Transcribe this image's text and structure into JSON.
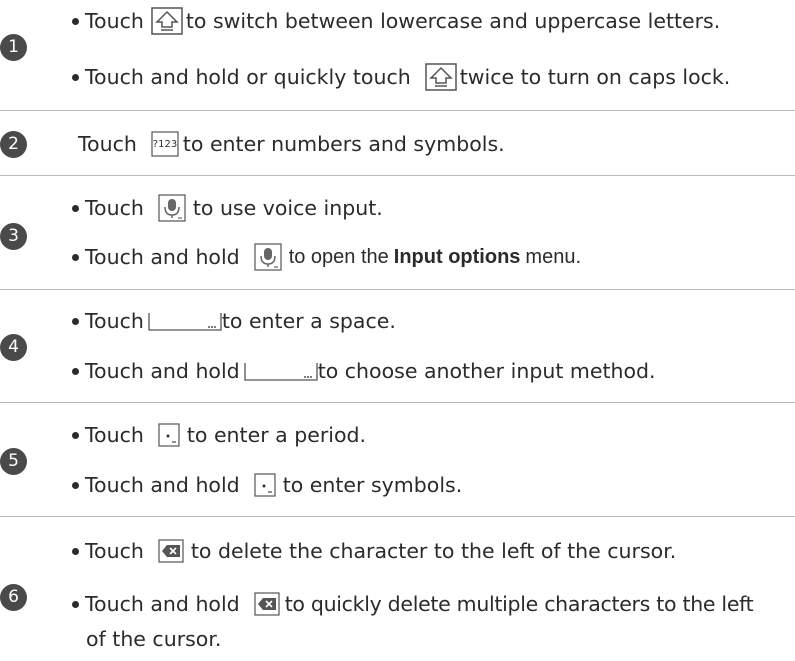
{
  "rows": [
    {
      "number": "1",
      "lines": [
        {
          "before": "Touch",
          "icon": "shift-icon",
          "after": "to switch between lowercase and uppercase letters."
        },
        {
          "before": "Touch and hold or quickly touch",
          "icon": "shift-icon",
          "after": "twice to turn on caps lock."
        }
      ]
    },
    {
      "number": "2",
      "lines": [
        {
          "before": "Touch",
          "icon": "numbers-symbols-key-icon",
          "icon_text": "?123",
          "after": "to enter numbers and symbols."
        }
      ]
    },
    {
      "number": "3",
      "lines": [
        {
          "before": "Touch",
          "icon": "microphone-icon",
          "after": "to use voice input."
        },
        {
          "before": "Touch and hold",
          "icon": "microphone-icon",
          "after_pre": "to open the",
          "after_bold": "Input options",
          "after_post": "menu."
        }
      ]
    },
    {
      "number": "4",
      "lines": [
        {
          "before": "Touch",
          "icon": "space-bar-icon",
          "after": "to enter a space."
        },
        {
          "before": "Touch and hold",
          "icon": "space-bar-icon",
          "after": "to choose another input method."
        }
      ]
    },
    {
      "number": "5",
      "lines": [
        {
          "before": "Touch",
          "icon": "period-key-icon",
          "after": "to enter a period."
        },
        {
          "before": "Touch and hold",
          "icon": "period-key-icon",
          "after": "to enter symbols."
        }
      ]
    },
    {
      "number": "6",
      "lines": [
        {
          "before": "Touch",
          "icon": "backspace-icon",
          "after": "to delete the character to the left of the cursor."
        },
        {
          "before": "Touch and hold",
          "icon": "backspace-icon",
          "after": "to quickly delete multiple characters to the left"
        },
        {
          "continuation": "of the cursor."
        }
      ]
    }
  ]
}
